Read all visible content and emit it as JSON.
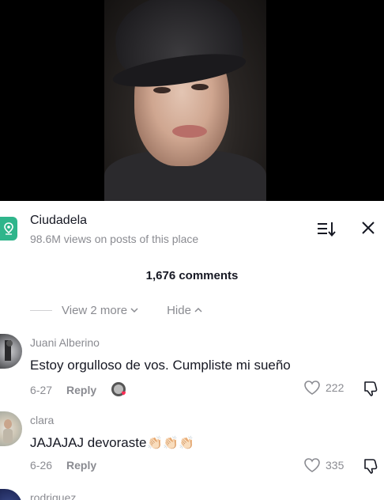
{
  "place": {
    "name": "Ciudadela",
    "views": "98.6M views on posts of this place",
    "icon": "map-pin-icon",
    "accent": "#2fb58b"
  },
  "comments_header": {
    "count_label": "1,676 comments"
  },
  "thread": {
    "view_more_label": "View 2 more",
    "hide_label": "Hide"
  },
  "comments": [
    {
      "user": "Juani Alberino",
      "text": "Estoy orgulloso de vos. Cumpliste mi sueño",
      "date": "6-27",
      "reply_label": "Reply",
      "likes": "222",
      "liked_by_creator": true
    },
    {
      "user": "clara",
      "text": "JAJAJAJ devoraste",
      "emojis": "👏🏻👏🏻👏🏻",
      "date": "6-26",
      "reply_label": "Reply",
      "likes": "335"
    },
    {
      "user": "rodriguez"
    }
  ],
  "colors": {
    "text_primary": "#161823",
    "text_secondary": "#8a8b91",
    "like_heart": "#ff2c55"
  }
}
